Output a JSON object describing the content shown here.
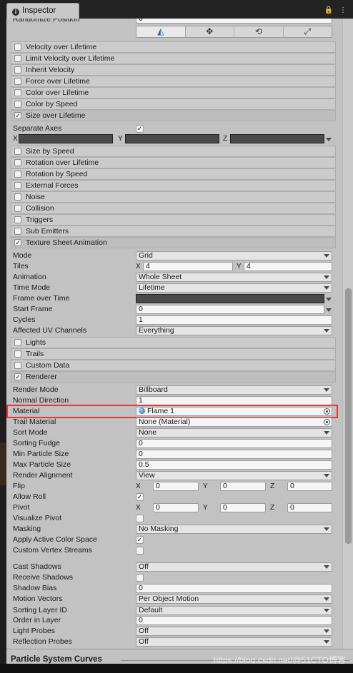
{
  "tab": {
    "title": "Inspector",
    "tools": "🔒 ⋮"
  },
  "top": {
    "randomize_label": "Randomize Position",
    "randomize_value": "0"
  },
  "modules": [
    "Velocity over Lifetime",
    "Limit Velocity over Lifetime",
    "Inherit Velocity",
    "Force over Lifetime",
    "Color over Lifetime",
    "Color by Speed",
    "Size over Lifetime",
    "Size by Speed",
    "Rotation over Lifetime",
    "Rotation by Speed",
    "External Forces",
    "Noise",
    "Collision",
    "Triggers",
    "Sub Emitters",
    "Texture Sheet Animation",
    "Lights",
    "Trails",
    "Custom Data",
    "Renderer"
  ],
  "size_over_lifetime": {
    "separate_axes": "Separate Axes",
    "x": "X",
    "y": "Y",
    "z": "Z"
  },
  "texture_sheet": {
    "mode_label": "Mode",
    "mode": "Grid",
    "tiles_label": "Tiles",
    "tiles_x": "4",
    "tiles_y": "4",
    "animation_label": "Animation",
    "animation": "Whole Sheet",
    "time_mode_label": "Time Mode",
    "time_mode": "Lifetime",
    "frame_over_time_label": "Frame over Time",
    "start_frame_label": "Start Frame",
    "start_frame": "0",
    "cycles_label": "Cycles",
    "cycles": "1",
    "uv_label": "Affected UV Channels",
    "uv": "Everything"
  },
  "renderer": {
    "render_mode_label": "Render Mode",
    "render_mode": "Billboard",
    "normal_direction_label": "Normal Direction",
    "normal_direction": "1",
    "material_label": "Material",
    "material": "Flame 1",
    "trail_material_label": "Trail Material",
    "trail_material": "None (Material)",
    "sort_mode_label": "Sort Mode",
    "sort_mode": "None",
    "sorting_fudge_label": "Sorting Fudge",
    "sorting_fudge": "0",
    "min_size_label": "Min Particle Size",
    "min_size": "0",
    "max_size_label": "Max Particle Size",
    "max_size": "0.5",
    "alignment_label": "Render Alignment",
    "alignment": "View",
    "flip_label": "Flip",
    "flip_x": "0",
    "flip_y": "0",
    "flip_z": "0",
    "allow_roll_label": "Allow Roll",
    "pivot_label": "Pivot",
    "pivot_x": "0",
    "pivot_y": "0",
    "pivot_z": "0",
    "visualize_pivot_label": "Visualize Pivot",
    "masking_label": "Masking",
    "masking": "No Masking",
    "color_space_label": "Apply Active Color Space",
    "custom_streams_label": "Custom Vertex Streams",
    "cast_shadows_label": "Cast Shadows",
    "cast_shadows": "Off",
    "receive_shadows_label": "Receive Shadows",
    "shadow_bias_label": "Shadow Bias",
    "shadow_bias": "0",
    "motion_vectors_label": "Motion Vectors",
    "motion_vectors": "Per Object Motion",
    "sorting_layer_label": "Sorting Layer ID",
    "sorting_layer": "Default",
    "order_label": "Order in Layer",
    "order": "0",
    "light_probes_label": "Light Probes",
    "light_probes": "Off",
    "reflection_probes_label": "Reflection Probes",
    "reflection_probes": "Off"
  },
  "curves": {
    "title": "Particle System Curves"
  },
  "watermark": "https://blog.csdn.net/@51CTO博客"
}
